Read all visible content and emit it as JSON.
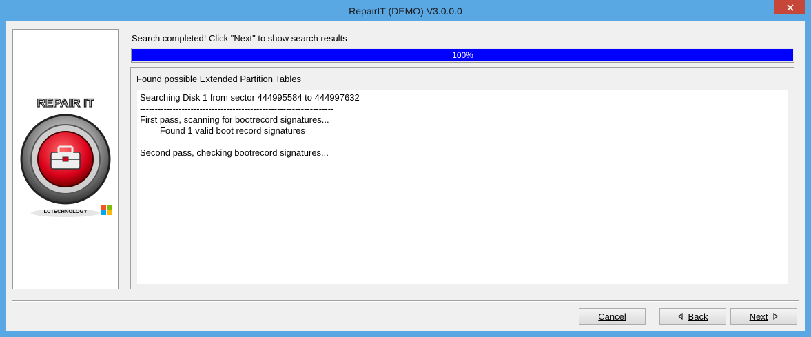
{
  "window": {
    "title": "RepairIT (DEMO) V3.0.0.0"
  },
  "sidebar": {
    "logo_text": "REPAIR IT",
    "vendor_text": "LCTECHNOLOGY"
  },
  "status": {
    "message": "Search completed! Click \"Next\" to show search results"
  },
  "progress": {
    "percent_text": "100%",
    "value": 1.0
  },
  "group": {
    "title": "Found possible Extended Partition Tables"
  },
  "log": {
    "lines": [
      "Searching Disk 1 from sector 444995584 to 444997632",
      "-----------------------------------------------------------------",
      "First pass, scanning for bootrecord signatures...",
      "        Found 1 valid boot record signatures",
      "",
      "Second pass, checking bootrecord signatures..."
    ]
  },
  "buttons": {
    "cancel": "Cancel",
    "back": "Back",
    "next": "Next"
  },
  "colors": {
    "progress": "#0000ff",
    "titlebar": "#59a8e4",
    "close": "#c7463a"
  }
}
